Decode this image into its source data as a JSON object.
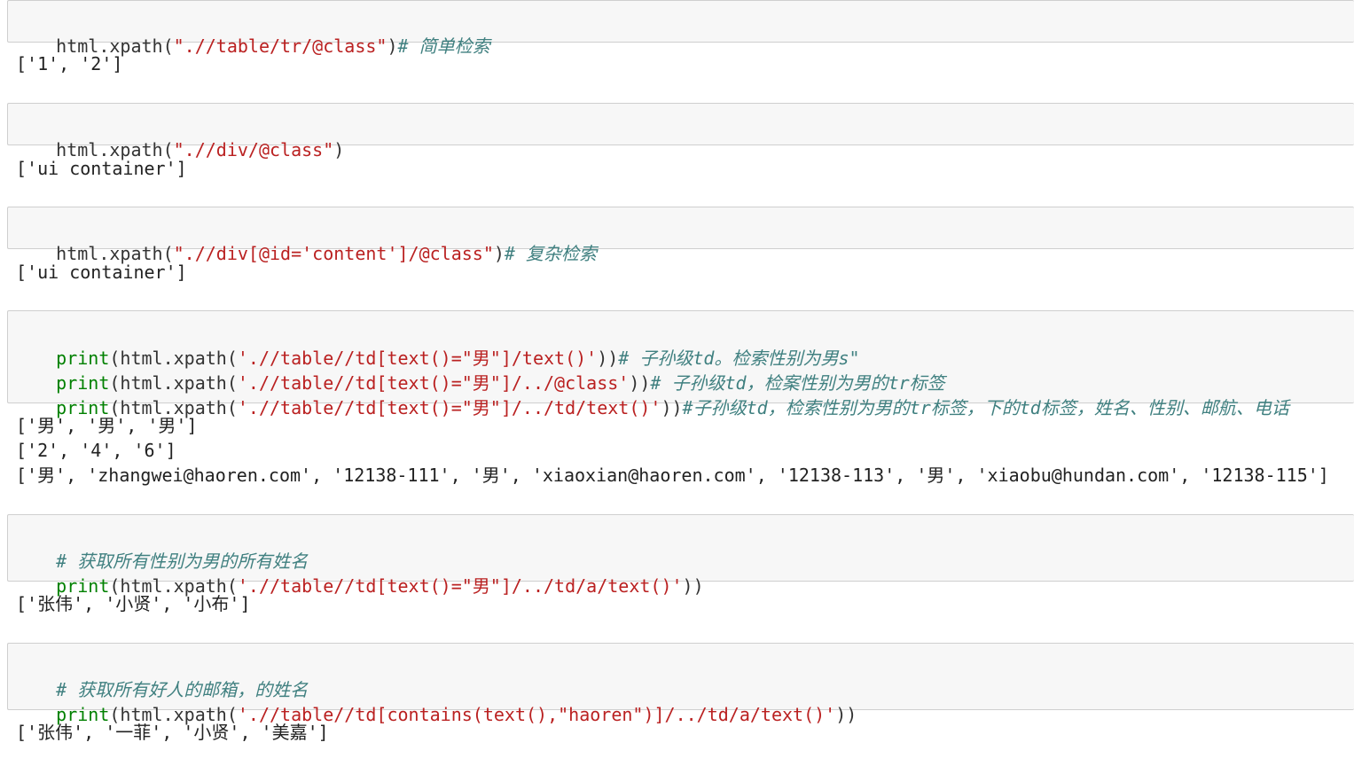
{
  "colors": {
    "keyword": "#008000",
    "string": "#ba2121",
    "comment": "#408080",
    "plain": "#333333",
    "input_bg": "#f7f7f7",
    "input_border": "#cfcfcf"
  },
  "cells": [
    {
      "input": [
        [
          {
            "t": "pl",
            "s": "html.xpath("
          },
          {
            "t": "str",
            "s": "\"./"
          },
          {
            "t": "str",
            "s": "/table/tr/@class\""
          },
          {
            "t": "pl",
            "s": ")"
          },
          {
            "t": "cm",
            "s": "# 简单检索"
          }
        ]
      ],
      "output": [
        "['1', '2']"
      ]
    },
    {
      "input": [
        [
          {
            "t": "pl",
            "s": "html.xpath("
          },
          {
            "t": "str",
            "s": "\".//div/@class\""
          },
          {
            "t": "pl",
            "s": ")"
          }
        ]
      ],
      "output": [
        "['ui container']"
      ]
    },
    {
      "input": [
        [
          {
            "t": "pl",
            "s": "html.xpath("
          },
          {
            "t": "str",
            "s": "\".//div[@id='content']/@class\""
          },
          {
            "t": "pl",
            "s": ")"
          },
          {
            "t": "cm",
            "s": "# 复杂检索"
          }
        ]
      ],
      "output": [
        "['ui container']"
      ]
    },
    {
      "input": [
        [
          {
            "t": "kw",
            "s": "print"
          },
          {
            "t": "pl",
            "s": "(html.xpath("
          },
          {
            "t": "str",
            "s": "'.//table//td[text()=\"男\"]/text()'"
          },
          {
            "t": "pl",
            "s": "))"
          },
          {
            "t": "cm",
            "s": "# 子孙级td。检索性别为男s\""
          }
        ],
        [
          {
            "t": "kw",
            "s": "print"
          },
          {
            "t": "pl",
            "s": "(html.xpath("
          },
          {
            "t": "str",
            "s": "'.//table//td[text()=\"男\"]/../@class'"
          },
          {
            "t": "pl",
            "s": "))"
          },
          {
            "t": "cm",
            "s": "# 子孙级td，检案性别为男的tr标签"
          }
        ],
        [
          {
            "t": "kw",
            "s": "print"
          },
          {
            "t": "pl",
            "s": "(html.xpath("
          },
          {
            "t": "str",
            "s": "'.//table//td[text()=\"男\"]/../td/text()'"
          },
          {
            "t": "pl",
            "s": "))"
          },
          {
            "t": "cm",
            "s": "#子孙级td，检索性别为男的tr标签，下的td标签，姓名、性别、邮航、电话"
          }
        ]
      ],
      "output": [
        "['男', '男', '男']",
        "['2', '4', '6']",
        "['男', 'zhangwei@haoren.com', '12138-111', '男', 'xiaoxian@haoren.com', '12138-113', '男', 'xiaobu@hundan.com', '12138-115']"
      ]
    },
    {
      "input": [
        [
          {
            "t": "cm",
            "s": "# 获取所有性别为男的所有姓名"
          }
        ],
        [
          {
            "t": "kw",
            "s": "print"
          },
          {
            "t": "pl",
            "s": "(html.xpath("
          },
          {
            "t": "str",
            "s": "'.//table//td[text()=\"男\"]/../td/a/text()'"
          },
          {
            "t": "pl",
            "s": "))"
          }
        ]
      ],
      "output": [
        "['张伟', '小贤', '小布']"
      ]
    },
    {
      "input": [
        [
          {
            "t": "cm",
            "s": "# 获取所有好人的邮箱，的姓名"
          }
        ],
        [
          {
            "t": "kw",
            "s": "print"
          },
          {
            "t": "pl",
            "s": "(html.xpath("
          },
          {
            "t": "str",
            "s": "'.//table//td[contains(text(),\"haoren\")]/../td/a/text()'"
          },
          {
            "t": "pl",
            "s": "))"
          }
        ]
      ],
      "output": [
        "['张伟', '一菲', '小贤', '美嘉']"
      ]
    }
  ]
}
